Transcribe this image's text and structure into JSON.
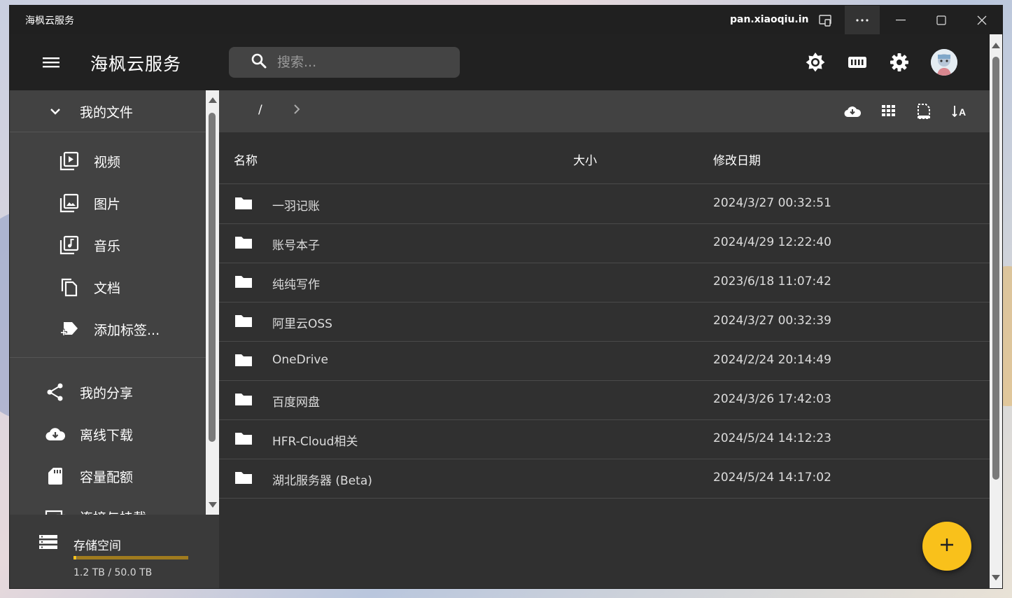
{
  "window": {
    "title": "海枫云服务",
    "domain": "pan.xiaoqiu.in"
  },
  "appbar": {
    "brand": "海枫云服务",
    "search_placeholder": "搜索..."
  },
  "sidebar": {
    "my_files": "我的文件",
    "categories": [
      {
        "label": "视频",
        "icon": "video-library-icon"
      },
      {
        "label": "图片",
        "icon": "photo-library-icon"
      },
      {
        "label": "音乐",
        "icon": "music-library-icon"
      },
      {
        "label": "文档",
        "icon": "file-copy-icon"
      },
      {
        "label": "添加标签...",
        "icon": "tag-add-icon"
      }
    ],
    "links": [
      {
        "label": "我的分享",
        "icon": "share-icon"
      },
      {
        "label": "离线下载",
        "icon": "cloud-download-icon"
      },
      {
        "label": "容量配额",
        "icon": "sd-card-icon"
      },
      {
        "label": "连接与挂载",
        "icon": "connection-icon"
      }
    ],
    "storage": {
      "label": "存储空间",
      "usage": "1.2 TB / 50.0 TB",
      "used_fraction": 0.024
    }
  },
  "breadcrumb": {
    "root": "/"
  },
  "table": {
    "headers": {
      "name": "名称",
      "size": "大小",
      "modified": "修改日期"
    },
    "rows": [
      {
        "name": "一羽记账",
        "date": "2024/3/27 00:32:51"
      },
      {
        "name": "账号本子",
        "date": "2024/4/29 12:22:40"
      },
      {
        "name": "纯纯写作",
        "date": "2023/6/18 11:07:42"
      },
      {
        "name": "阿里云OSS",
        "date": "2024/3/27 00:32:39"
      },
      {
        "name": "OneDrive",
        "date": "2024/2/24 20:14:49"
      },
      {
        "name": "百度网盘",
        "date": "2024/3/26 17:42:03"
      },
      {
        "name": "HFR-Cloud相关",
        "date": "2024/5/24 14:12:23"
      },
      {
        "name": "湖北服务器 (Beta)",
        "date": "2024/5/24 14:17:02"
      }
    ]
  },
  "colors": {
    "accent": "#f9c11b",
    "appbar": "#212121",
    "sidebar": "#424242",
    "main": "#303030"
  }
}
